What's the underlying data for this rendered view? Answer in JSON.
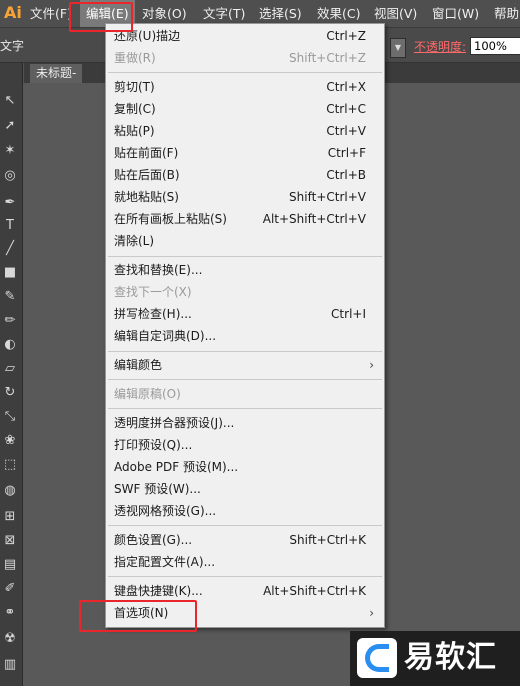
{
  "app": {
    "logo": "Ai"
  },
  "menubar": {
    "items": [
      {
        "label": "文件(F)"
      },
      {
        "label": "编辑(E)"
      },
      {
        "label": "对象(O)"
      },
      {
        "label": "文字(T)"
      },
      {
        "label": "选择(S)"
      },
      {
        "label": "效果(C)"
      },
      {
        "label": "视图(V)"
      },
      {
        "label": "窗口(W)"
      },
      {
        "label": "帮助"
      }
    ]
  },
  "toolbar": {
    "left_label": "文字",
    "opacity_label": "不透明度:",
    "opacity_value": "100%"
  },
  "document": {
    "tab_label": "未标题-"
  },
  "edit_menu": {
    "items": [
      {
        "label": "还原(U)描边",
        "shortcut": "Ctrl+Z"
      },
      {
        "label": "重做(R)",
        "shortcut": "Shift+Ctrl+Z"
      },
      {
        "label": "剪切(T)",
        "shortcut": "Ctrl+X"
      },
      {
        "label": "复制(C)",
        "shortcut": "Ctrl+C"
      },
      {
        "label": "粘贴(P)",
        "shortcut": "Ctrl+V"
      },
      {
        "label": "贴在前面(F)",
        "shortcut": "Ctrl+F"
      },
      {
        "label": "贴在后面(B)",
        "shortcut": "Ctrl+B"
      },
      {
        "label": "就地粘贴(S)",
        "shortcut": "Shift+Ctrl+V"
      },
      {
        "label": "在所有画板上粘贴(S)",
        "shortcut": "Alt+Shift+Ctrl+V"
      },
      {
        "label": "清除(L)",
        "shortcut": ""
      },
      {
        "label": "查找和替换(E)...",
        "shortcut": ""
      },
      {
        "label": "查找下一个(X)",
        "shortcut": ""
      },
      {
        "label": "拼写检查(H)...",
        "shortcut": "Ctrl+I"
      },
      {
        "label": "编辑自定词典(D)...",
        "shortcut": ""
      },
      {
        "label": "编辑颜色",
        "shortcut": ""
      },
      {
        "label": "编辑原稿(O)",
        "shortcut": ""
      },
      {
        "label": "透明度拼合器预设(J)...",
        "shortcut": ""
      },
      {
        "label": "打印预设(Q)...",
        "shortcut": ""
      },
      {
        "label": "Adobe PDF 预设(M)...",
        "shortcut": ""
      },
      {
        "label": "SWF 预设(W)...",
        "shortcut": ""
      },
      {
        "label": "透视网格预设(G)...",
        "shortcut": ""
      },
      {
        "label": "颜色设置(G)...",
        "shortcut": "Shift+Ctrl+K"
      },
      {
        "label": "指定配置文件(A)...",
        "shortcut": ""
      },
      {
        "label": "键盘快捷键(K)...",
        "shortcut": "Alt+Shift+Ctrl+K"
      },
      {
        "label": "首选项(N)",
        "shortcut": ""
      }
    ]
  },
  "watermark": {
    "text": "易软汇"
  },
  "colors": {
    "highlight": "#e8262c",
    "opacity_label": "#ff6a6a",
    "logo": "#f7a437",
    "watermark_e": "#2a8df0"
  }
}
